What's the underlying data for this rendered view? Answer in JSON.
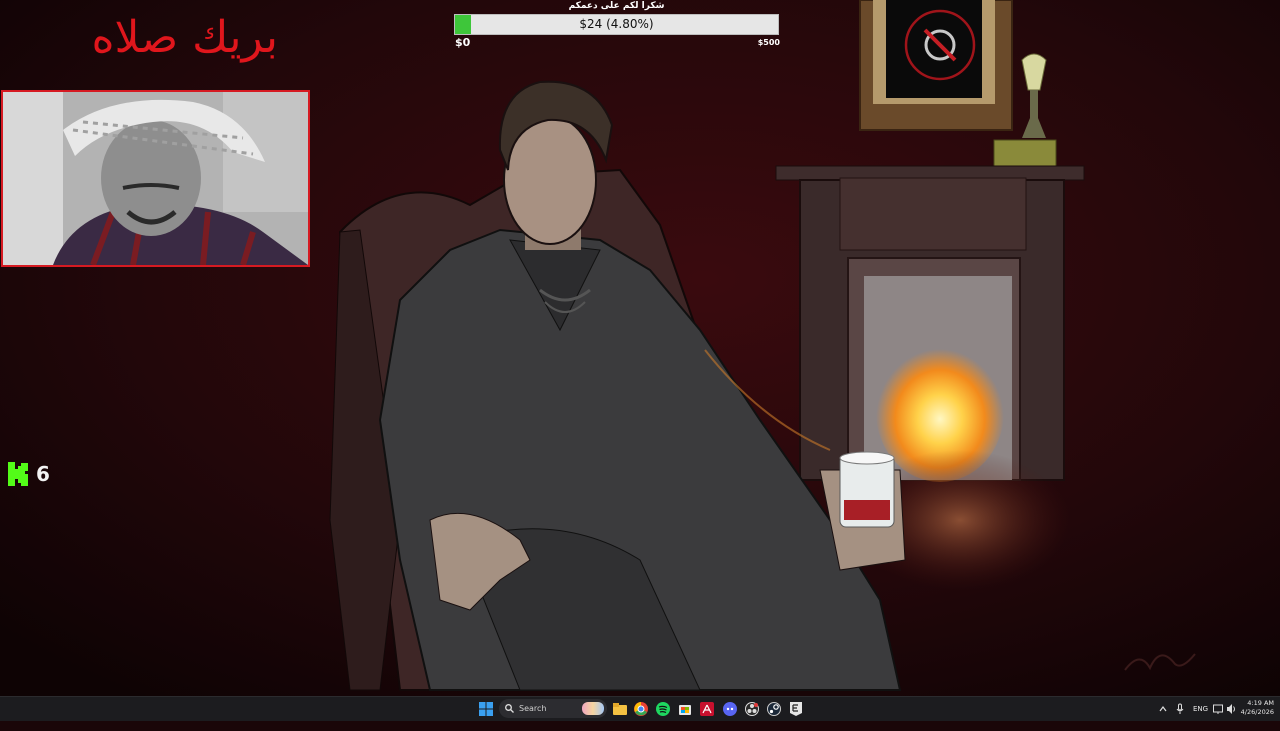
{
  "overlay": {
    "title": "بريك صلاه",
    "donation_goal": {
      "title": "شكرا لكم على دعمكم",
      "progress_text": "$24 (4.80%)",
      "min_label": "$0",
      "max_label": "$500",
      "progress_fraction": 0.048
    },
    "kick": {
      "icon": "kick-logo-icon",
      "viewer_count": "6"
    }
  },
  "taskbar": {
    "search_placeholder": "Search",
    "pinned_apps": [
      "windows-start-icon",
      "file-explorer-icon",
      "chrome-icon",
      "spotify-icon",
      "store-icon",
      "acrobat-icon",
      "discord-icon",
      "obs-icon",
      "steam-icon",
      "epic-games-icon"
    ],
    "tray": {
      "language": "ENG",
      "time": "4:19 AM",
      "date": "4/26/2026"
    }
  },
  "colors": {
    "background": "#1a0608",
    "title_red": "#e0161c",
    "goal_fill": "#3ec63a",
    "kick_green": "#53fc18",
    "taskbar": "#1c1c1f"
  }
}
